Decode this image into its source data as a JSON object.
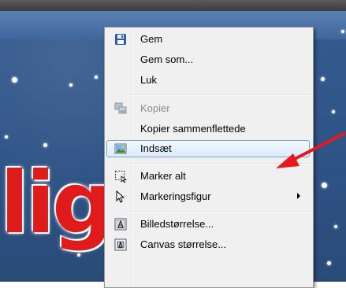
{
  "menu": {
    "items": [
      {
        "label": "Gem",
        "icon": "floppy-disk-icon",
        "enabled": true
      },
      {
        "label": "Gem som...",
        "icon": "",
        "enabled": true
      },
      {
        "label": "Luk",
        "icon": "",
        "enabled": true
      },
      {
        "label": "Kopier",
        "icon": "copy-icon",
        "enabled": false
      },
      {
        "label": "Kopier sammenflettede",
        "icon": "",
        "enabled": true
      },
      {
        "label": "Indsæt",
        "icon": "paste-image-icon",
        "enabled": true,
        "highlighted": true
      },
      {
        "label": "Marker alt",
        "icon": "select-all-icon",
        "enabled": true
      },
      {
        "label": "Markeringsfigur",
        "icon": "cursor-arrow-icon",
        "enabled": true,
        "submenu": true
      },
      {
        "label": "Billedstørrelse...",
        "icon": "image-size-icon",
        "enabled": true
      },
      {
        "label": "Canvas størrelse...",
        "icon": "canvas-size-icon",
        "enabled": true
      }
    ]
  },
  "background": {
    "text": "lig",
    "text_color": "#e01b1b",
    "sky_color": "#2f5386"
  },
  "annotation": {
    "arrow_color": "#e8191c"
  },
  "colors": {
    "highlight_border": "#7da2ce",
    "menu_background": "#f0f0f0"
  }
}
